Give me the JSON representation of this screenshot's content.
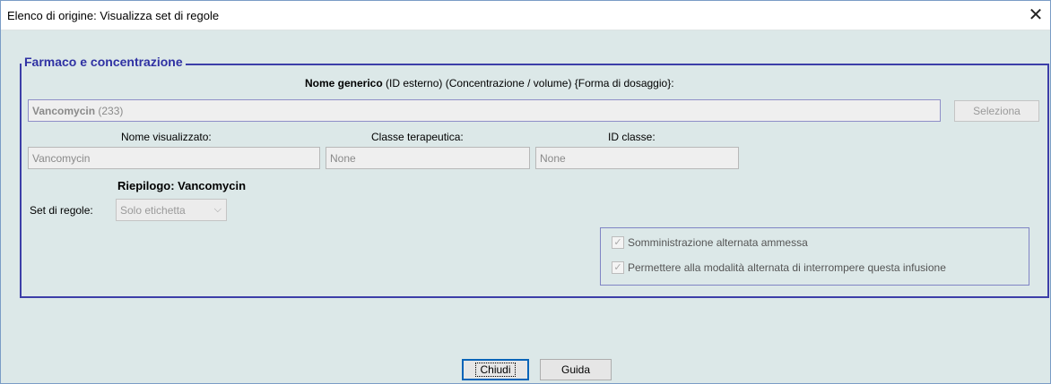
{
  "window": {
    "title": "Elenco di origine: Visualizza set di regole",
    "close_glyph": "✕"
  },
  "group": {
    "legend": "Farmaco e concentrazione",
    "header_bold": "Nome generico",
    "header_rest": "(ID esterno) (Concentrazione / volume) {Forma di dosaggio}:",
    "generic_name": "Vancomycin",
    "generic_id": "(233)",
    "select_button": "Seleziona",
    "display_name_label": "Nome visualizzato:",
    "display_name_value": "Vancomycin",
    "therapeutic_class_label": "Classe terapeutica:",
    "therapeutic_class_value": "None",
    "class_id_label": "ID classe:",
    "class_id_value": "None",
    "summary_title": "Riepilogo: Vancomycin",
    "ruleset_label": "Set di regole:",
    "ruleset_value": "Solo etichetta",
    "options": [
      {
        "label": "Somministrazione alternata ammessa",
        "checked": true
      },
      {
        "label": "Permettere alla modalità alternata di interrompere questa infusione",
        "checked": true
      }
    ]
  },
  "footer": {
    "close_button": "Chiudi",
    "help_button": "Guida"
  }
}
